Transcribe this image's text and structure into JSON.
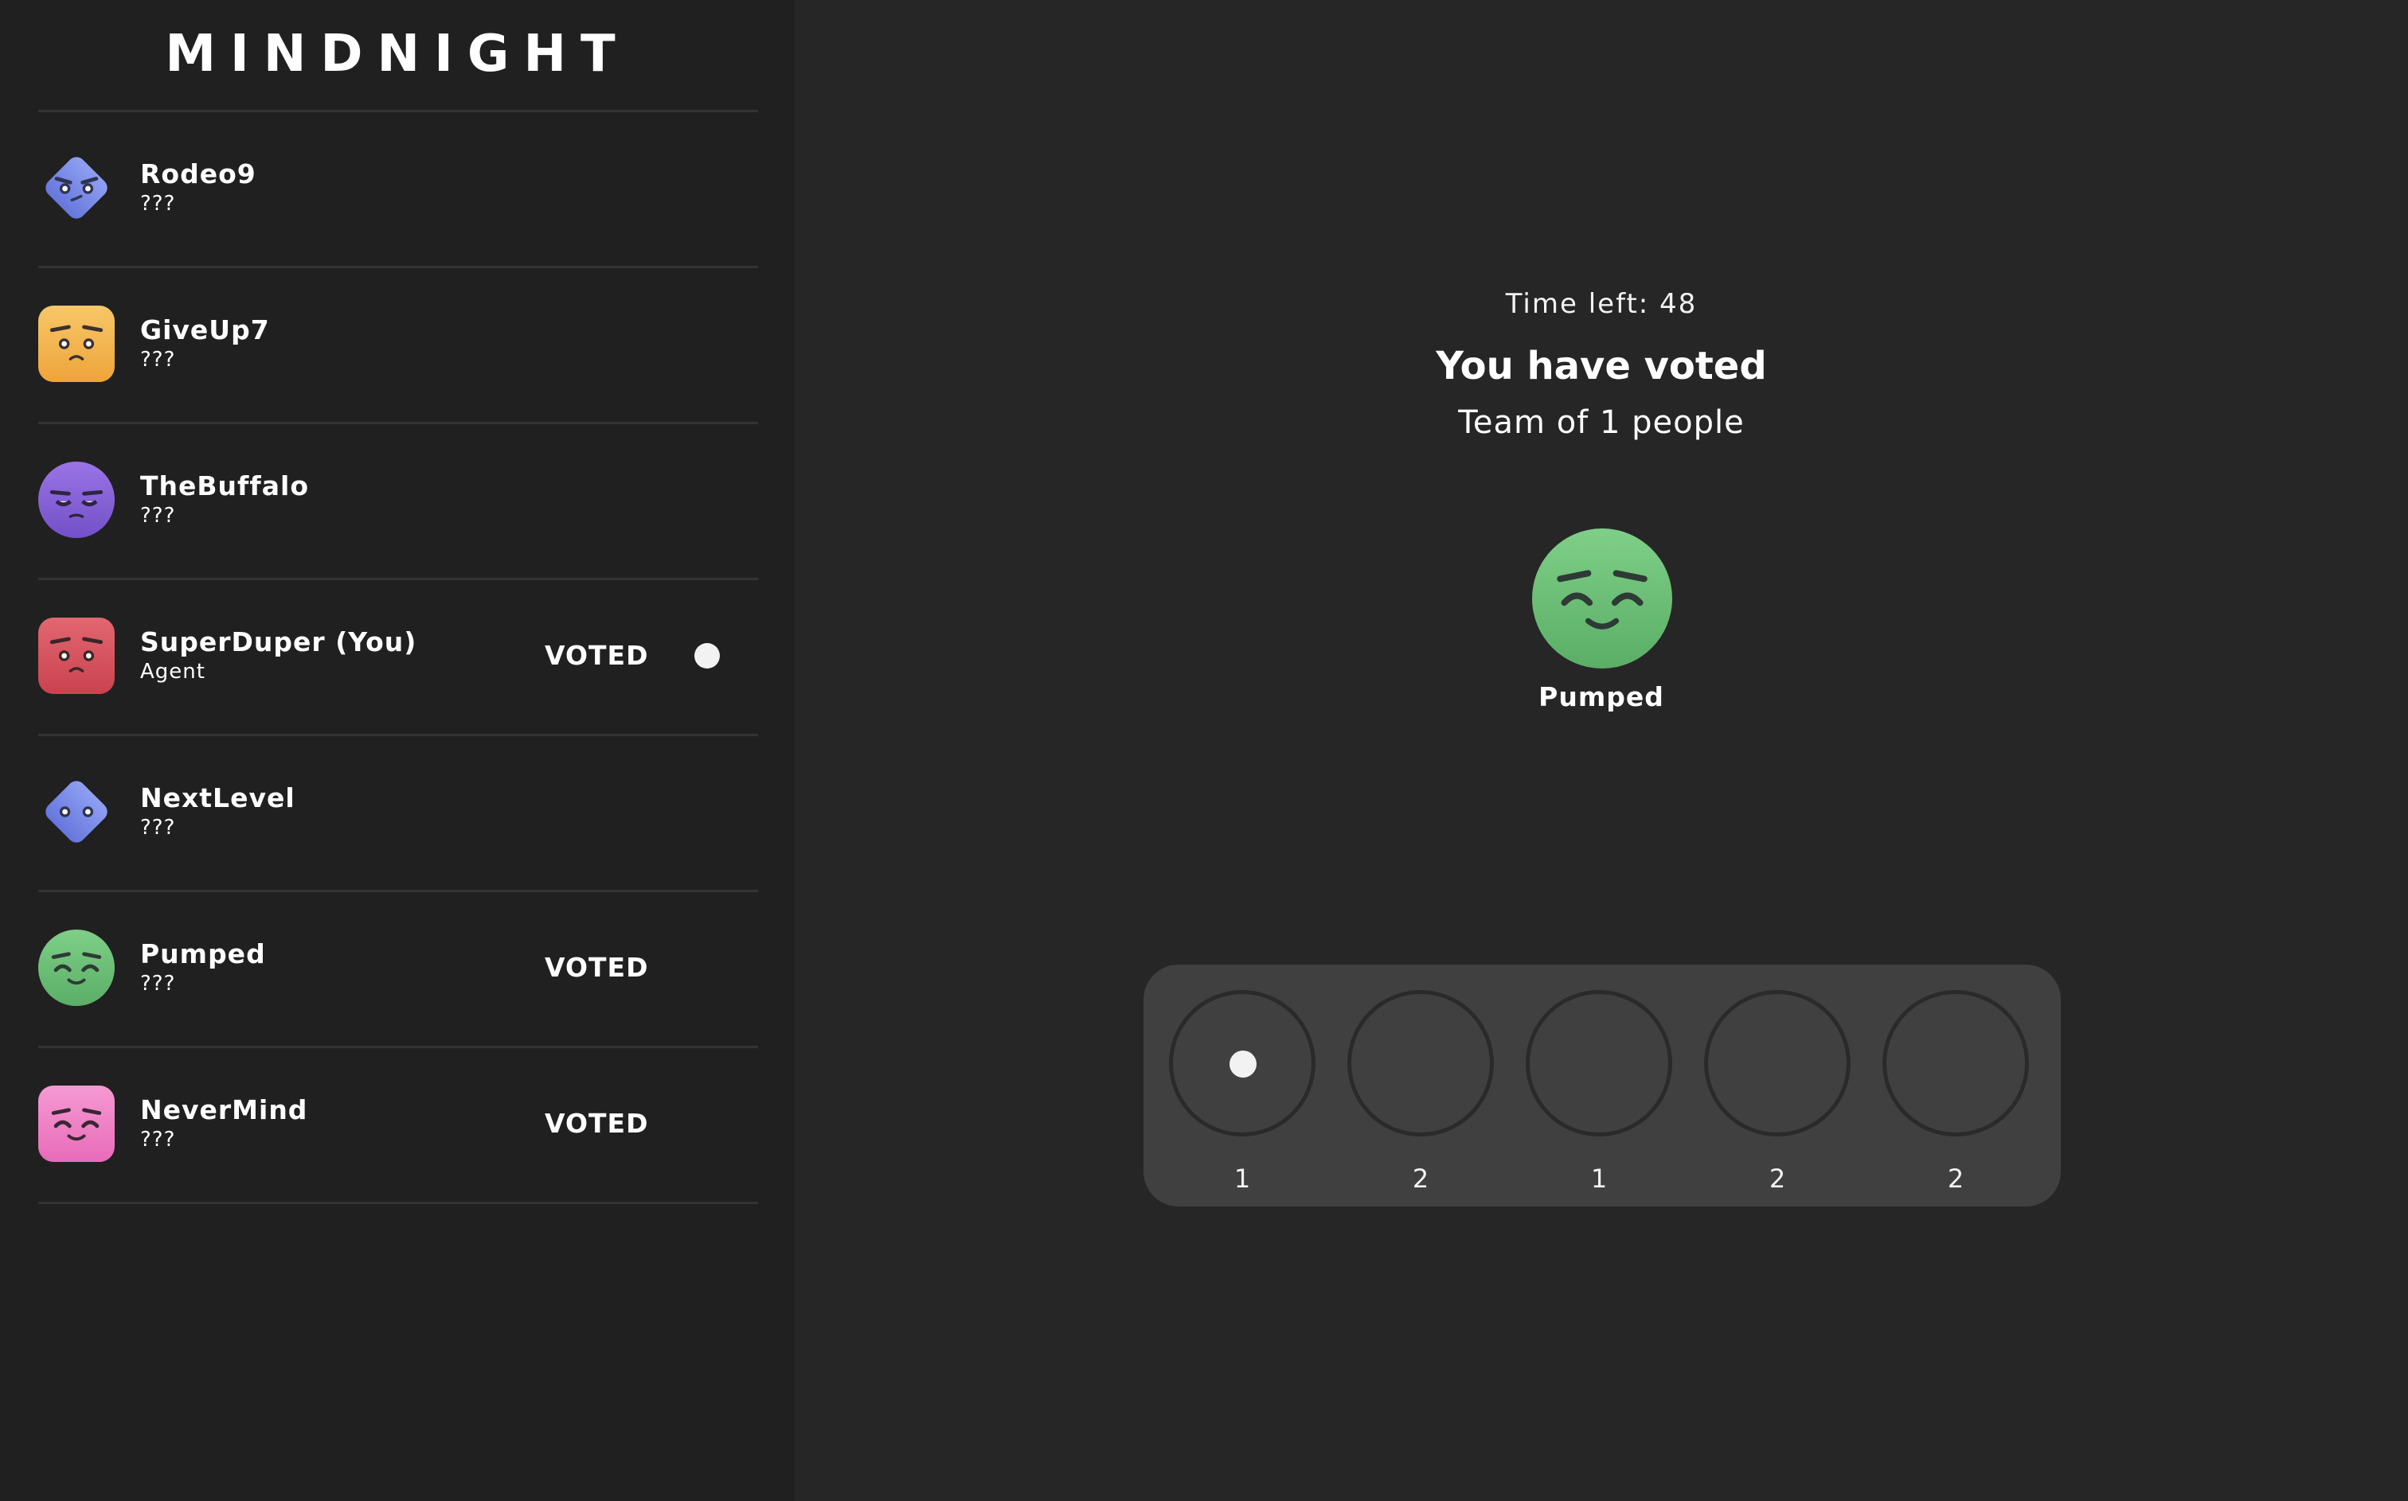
{
  "app": {
    "title": "MINDNIGHT"
  },
  "colors": {
    "background": "#262626",
    "sidebar": "#202020",
    "panel": "#404040",
    "text": "#ffffff"
  },
  "players": [
    {
      "name": "Rodeo9",
      "role": "???",
      "voted": "",
      "avatar": "blue-diamond-angry-icon",
      "color": "#7f8fe6"
    },
    {
      "name": "GiveUp7",
      "role": "???",
      "voted": "",
      "avatar": "yellow-square-worried-icon",
      "color": "#f3b54a"
    },
    {
      "name": "TheBuffalo",
      "role": "???",
      "voted": "",
      "avatar": "purple-circle-sleepy-icon",
      "color": "#8a62d8"
    },
    {
      "name": "SuperDuper (You)",
      "role": "Agent",
      "voted": "VOTED",
      "avatar": "red-square-worried-icon",
      "color": "#d9545f"
    },
    {
      "name": "NextLevel",
      "role": "???",
      "voted": "",
      "avatar": "blue-diamond-neutral-icon",
      "color": "#7f8fe6"
    },
    {
      "name": "Pumped",
      "role": "???",
      "voted": "VOTED",
      "avatar": "green-circle-happy-icon",
      "color": "#6fc27a"
    },
    {
      "name": "NeverMind",
      "role": "???",
      "voted": "VOTED",
      "avatar": "pink-square-happy-icon",
      "color": "#ef7fc6"
    }
  ],
  "vote_status": {
    "time_left": "Time left: 48",
    "title": "You have voted",
    "team": "Team of 1 people",
    "team_members": [
      {
        "name": "Pumped",
        "avatar": "green-circle-happy-icon",
        "color": "#6fc27a"
      }
    ]
  },
  "missions": [
    {
      "size": "1",
      "current": true
    },
    {
      "size": "2",
      "current": false
    },
    {
      "size": "1",
      "current": false
    },
    {
      "size": "2",
      "current": false
    },
    {
      "size": "2",
      "current": false
    }
  ]
}
